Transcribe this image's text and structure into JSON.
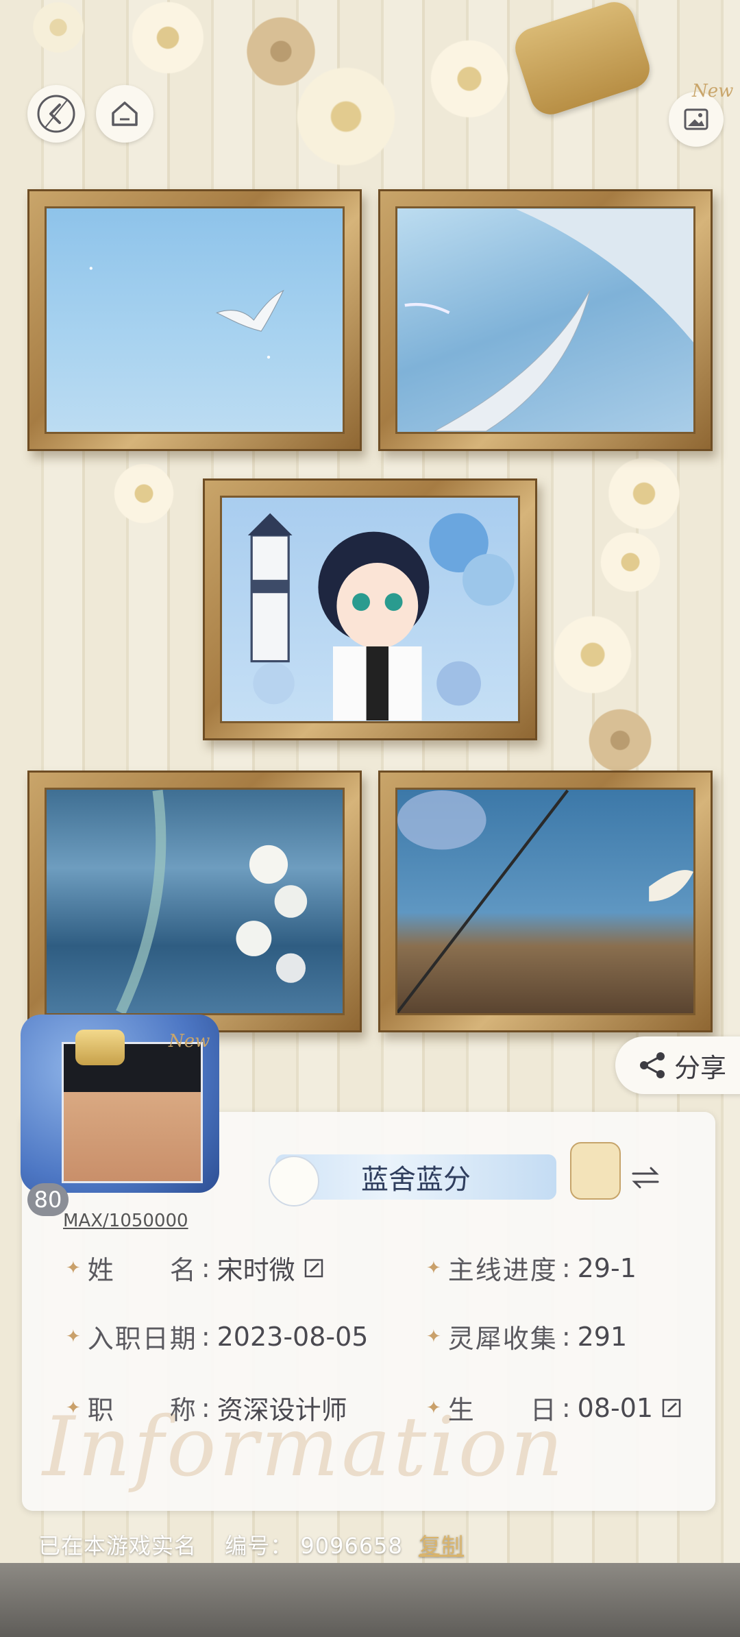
{
  "top_bar": {
    "back_icon": "back-arrow-icon",
    "home_icon": "home-icon",
    "gallery_icon": "photo-gallery-icon",
    "gallery_badge": "New"
  },
  "avatar": {
    "level": "80",
    "exp_text": "MAX/1050000",
    "badge": "New"
  },
  "share": {
    "label": "分享"
  },
  "nameplate": {
    "text": "蓝舍蓝分",
    "switch_icon": "swap-icon"
  },
  "profile": {
    "name_label": "姓　　名",
    "name_value": "宋时微",
    "join_label": "入职日期",
    "join_value": "2023-08-05",
    "title_label": "职　　称",
    "title_value": "资深设计师",
    "progress_label": "主线进度",
    "progress_value": "29-1",
    "collect_label": "灵犀收集",
    "collect_value": "291",
    "birthday_label": "生　　日",
    "birthday_value": "08-01",
    "separator": ":"
  },
  "watermark": "Information",
  "footer": {
    "realname": "已在本游戏实名",
    "id_label": "编号：",
    "id_value": "9096658",
    "copy_label": "复制"
  }
}
